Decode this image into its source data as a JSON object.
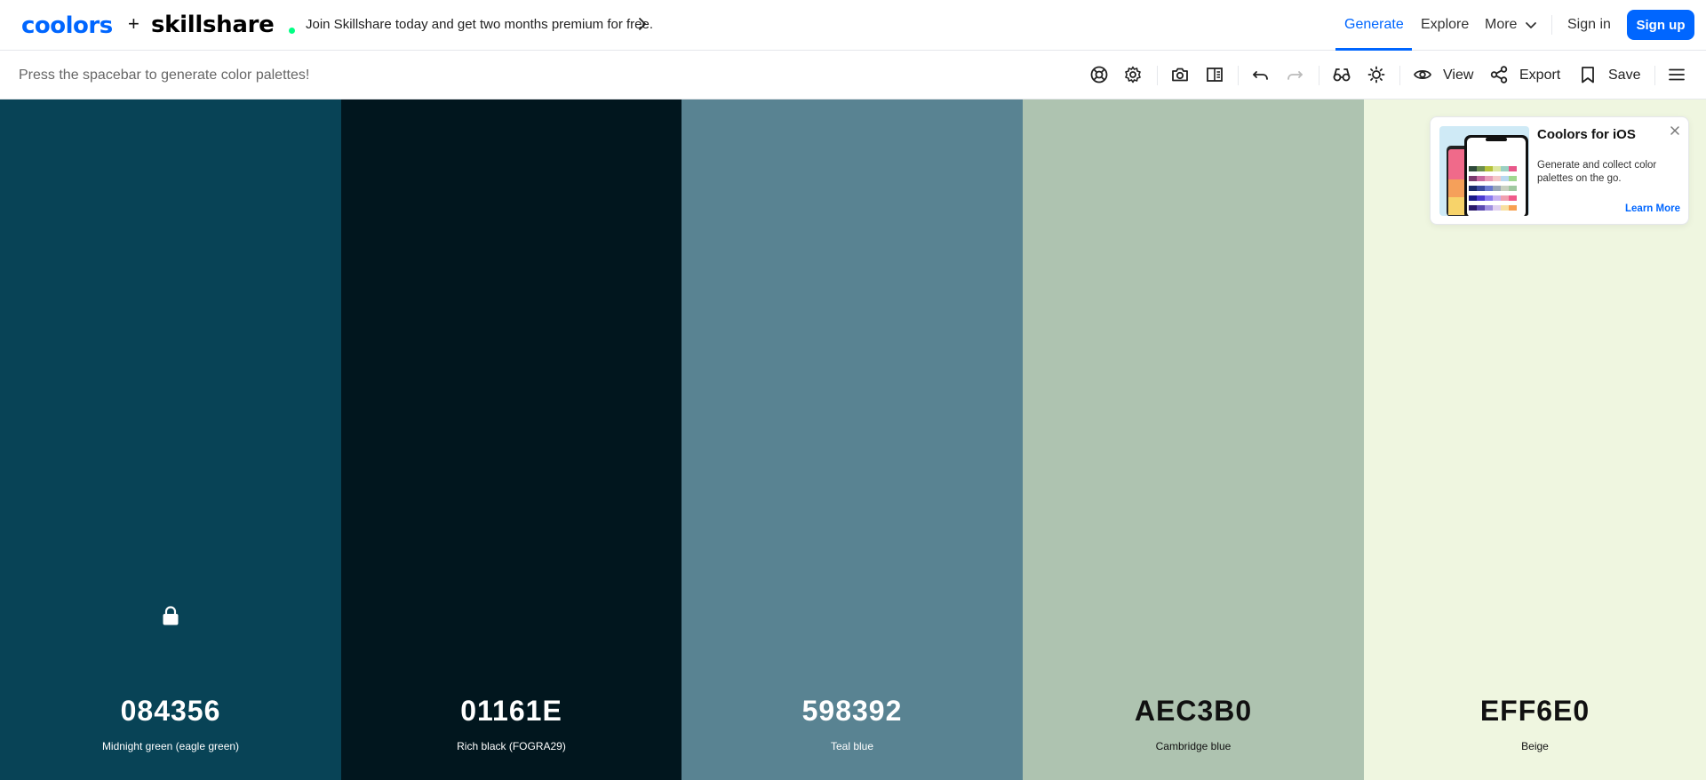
{
  "header": {
    "logo_coolors": "coolors",
    "plus": "+",
    "logo_skillshare": "skillshare",
    "promo_text": "Join Skillshare today and get two months premium for free.",
    "nav": {
      "generate": "Generate",
      "explore": "Explore",
      "more": "More"
    },
    "sign_in": "Sign in",
    "sign_up": "Sign up"
  },
  "toolbar": {
    "hint": "Press the spacebar to generate color palettes!",
    "view_label": "View",
    "export_label": "Export",
    "save_label": "Save"
  },
  "palette": [
    {
      "hex": "084356",
      "name": "Midnight green (eagle green)",
      "color": "#084356",
      "text_color": "#ffffff",
      "locked": true
    },
    {
      "hex": "01161E",
      "name": "Rich black (FOGRA29)",
      "color": "#01161e",
      "text_color": "#ffffff",
      "locked": false
    },
    {
      "hex": "598392",
      "name": "Teal blue",
      "color": "#598392",
      "text_color": "#ffffff",
      "locked": false
    },
    {
      "hex": "AEC3B0",
      "name": "Cambridge blue",
      "color": "#aec3b0",
      "text_color": "#111111",
      "locked": false
    },
    {
      "hex": "EFF6E0",
      "name": "Beige",
      "color": "#eff6e0",
      "text_color": "#111111",
      "locked": false
    }
  ],
  "ios_card": {
    "title": "Coolors for iOS",
    "description": "Generate and collect color palettes on the go.",
    "learn_more": "Learn More"
  },
  "icons": [
    "help-icon",
    "settings-icon",
    "camera-icon",
    "layout-icon",
    "undo-icon",
    "redo-icon",
    "glasses-icon",
    "sun-icon",
    "eye-icon",
    "share-icon",
    "bookmark-icon",
    "menu-icon",
    "lock-icon",
    "close-icon",
    "chevron-right-icon",
    "chevron-down-icon"
  ]
}
